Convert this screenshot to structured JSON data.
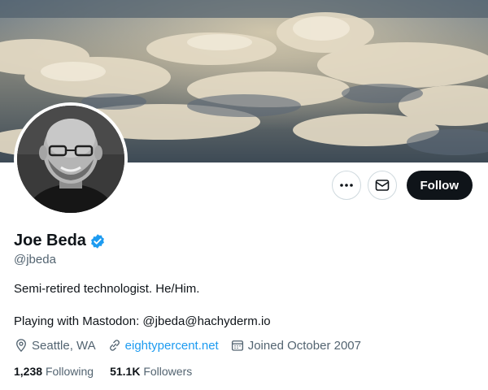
{
  "profile": {
    "display_name": "Joe Beda",
    "handle": "@jbeda",
    "verified": true,
    "bio_line1": "Semi-retired technologist. He/Him.",
    "bio_line2": "Playing with Mastodon: @jbeda@hachyderm.io",
    "location": "Seattle, WA",
    "website": "eightypercent.net",
    "joined": "Joined October 2007",
    "following_count": "1,238",
    "following_label": "Following",
    "followers_count": "51.1K",
    "followers_label": "Followers"
  },
  "actions": {
    "more_icon": "more-icon",
    "message_icon": "envelope-icon",
    "follow_label": "Follow"
  },
  "colors": {
    "accent": "#1d9bf0",
    "primary_text": "#0f1419",
    "secondary_text": "#536471",
    "follow_bg": "#0f1419"
  }
}
